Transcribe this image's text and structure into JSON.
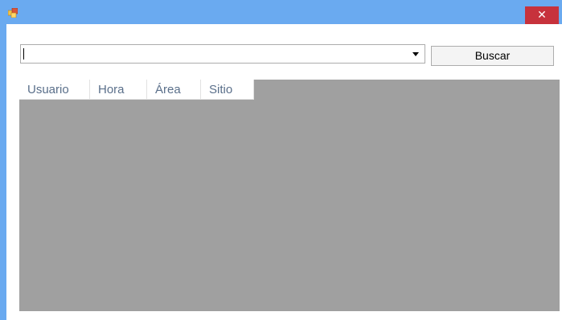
{
  "titlebar": {
    "close_label": "✕"
  },
  "combo": {
    "value": "",
    "placeholder": ""
  },
  "search_button": {
    "label": "Buscar"
  },
  "grid": {
    "columns": [
      "Usuario",
      "Hora",
      "Área",
      "Sitio"
    ],
    "rows": []
  },
  "colors": {
    "titlebar": "#6aaaf0",
    "close": "#c7323c",
    "grid_background": "#a0a0a0",
    "header_text": "#5a6f8a"
  },
  "icons": {
    "app": "app-icon",
    "close": "close-icon",
    "combo_arrow": "chevron-down-icon"
  }
}
